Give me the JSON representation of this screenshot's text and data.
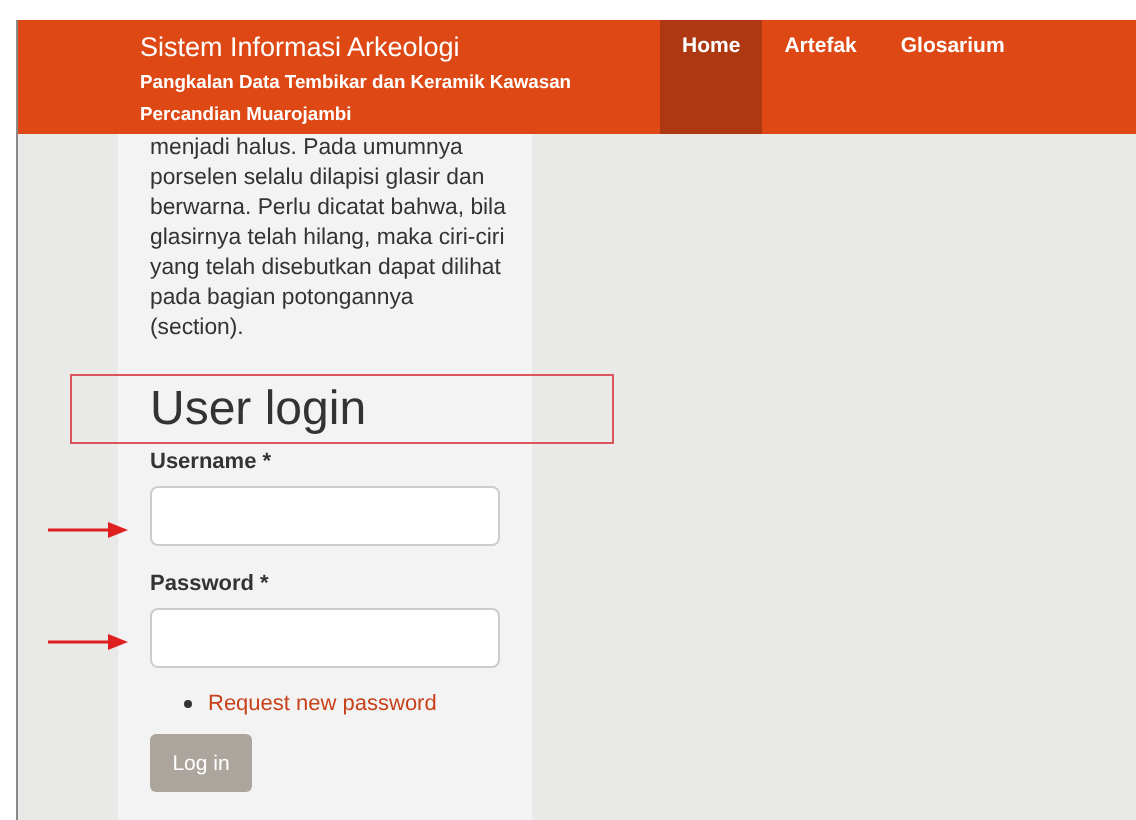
{
  "header": {
    "title": "Sistem Informasi Arkeologi",
    "subtitle": "Pangkalan Data Tembikar dan Keramik Kawasan Percandian Muarojambi"
  },
  "nav": [
    {
      "label": "Home",
      "selected": true
    },
    {
      "label": "Artefak",
      "selected": false
    },
    {
      "label": "Glosarium",
      "selected": false
    }
  ],
  "sidebar": {
    "paragraph": "menjadi halus. Pada umumnya porselen selalu dilapisi glasir dan berwarna. Perlu dicatat bahwa, bila glasirnya telah hilang, maka ciri-ciri yang telah disebutkan dapat dilihat pada bagian potongannya (section)."
  },
  "login": {
    "heading": "User login",
    "fields": [
      {
        "label": "Username *"
      },
      {
        "label": "Password *"
      }
    ],
    "links": [
      "Request new password"
    ],
    "button": "Log in"
  }
}
